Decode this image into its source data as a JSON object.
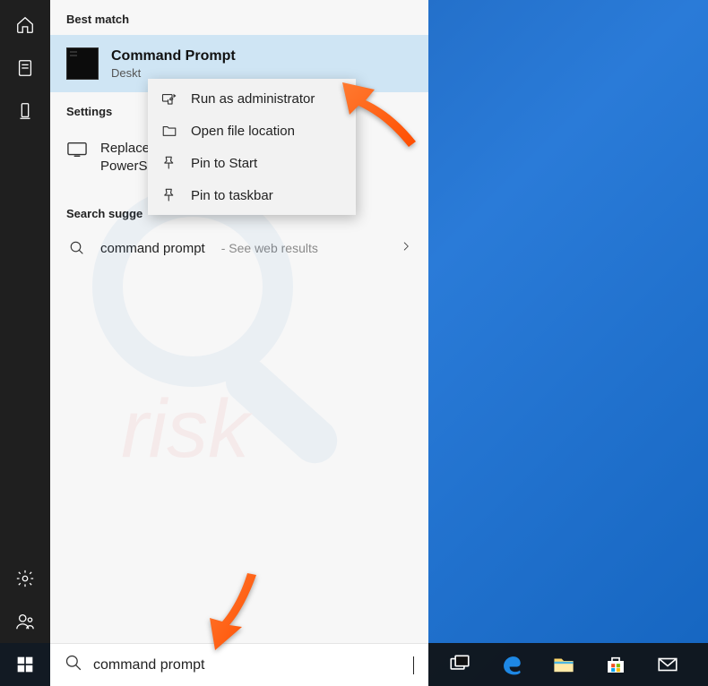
{
  "rail": {
    "items": [
      "home",
      "recent",
      "this-pc"
    ],
    "bottom": [
      "settings",
      "account"
    ]
  },
  "panel": {
    "best_match_label": "Best match",
    "best_match": {
      "title": "Command Prompt",
      "subtitle": "Deskt"
    },
    "settings_label": "Settings",
    "settings_item": "Replace                                           ndo\nPowerS                                         X menu",
    "suggestions_label": "Search sugge",
    "suggestion": {
      "text": "command prompt",
      "hint": "- See web results"
    }
  },
  "context_menu": {
    "items": [
      {
        "icon": "admin",
        "label": "Run as administrator"
      },
      {
        "icon": "folder",
        "label": "Open file location"
      },
      {
        "icon": "pin",
        "label": "Pin to Start"
      },
      {
        "icon": "pin",
        "label": "Pin to taskbar"
      }
    ]
  },
  "search": {
    "value": "command prompt"
  },
  "taskbar": {
    "items": [
      "task-view",
      "edge",
      "file-explorer",
      "store",
      "mail"
    ]
  },
  "colors": {
    "highlight": "#cfe5f4",
    "arrow": "#ff5a1f"
  }
}
